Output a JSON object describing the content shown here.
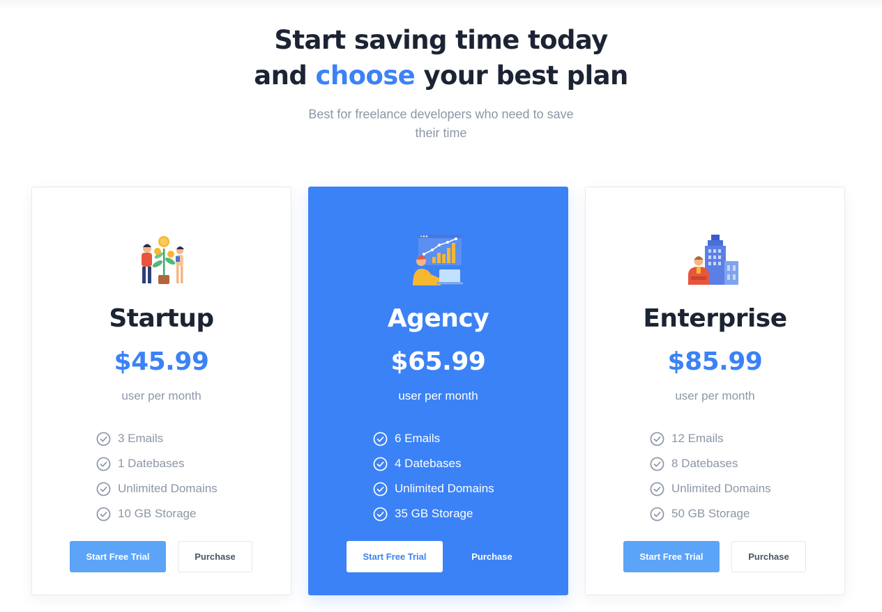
{
  "header": {
    "title_line1": "Start saving time today",
    "title_line2_before": "and ",
    "title_line2_accent": "choose",
    "title_line2_after": " your best plan",
    "subtitle": "Best for freelance developers who need to save their time"
  },
  "colors": {
    "accent": "#3b82f6",
    "dark_text": "#1c2434",
    "muted_text": "#8d96a6",
    "trial_button": "#5ba4f8"
  },
  "plans": [
    {
      "name": "Startup",
      "price": "$45.99",
      "period": "user per month",
      "features": [
        "3 Emails",
        "1 Datebases",
        "Unlimited Domains",
        "10 GB Storage"
      ],
      "trial_label": "Start Free Trial",
      "purchase_label": "Purchase",
      "icon": "money-plant-illustration-icon"
    },
    {
      "name": "Agency",
      "price": "$65.99",
      "period": "user per month",
      "features": [
        "6 Emails",
        "4 Datebases",
        "Unlimited Domains",
        "35 GB Storage"
      ],
      "trial_label": "Start Free Trial",
      "purchase_label": "Purchase",
      "icon": "growth-chart-laptop-illustration-icon"
    },
    {
      "name": "Enterprise",
      "price": "$85.99",
      "period": "user per month",
      "features": [
        "12 Emails",
        "8 Datebases",
        "Unlimited Domains",
        "50 GB Storage"
      ],
      "trial_label": "Start Free Trial",
      "purchase_label": "Purchase",
      "icon": "office-building-illustration-icon"
    }
  ]
}
